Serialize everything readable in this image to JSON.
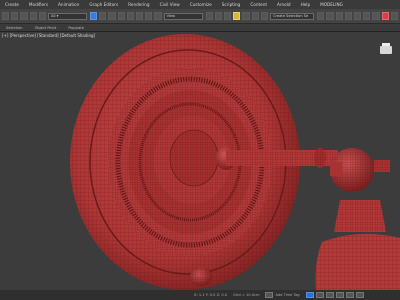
{
  "menu": [
    "Create",
    "Modifiers",
    "Animation",
    "Graph Editors",
    "Rendering",
    "Civil View",
    "Customize",
    "Scripting",
    "Content",
    "Arnold",
    "Help",
    "MODELING"
  ],
  "toolbar": {
    "view_dropdown": "View",
    "selection_set_dropdown": "Create Selection Se"
  },
  "subbar": [
    "Selection",
    "Object Paint",
    "Populate"
  ],
  "viewport": {
    "label": "[+] [Perspective] [Standard] [Default Shading]"
  },
  "status": {
    "coords": "X: 1.1  Y: 0.0  Z: 0.0",
    "grid": "Grid = 10.0cm",
    "add_time_tag": "Add Time Tag"
  },
  "colors": {
    "mesh": "#b83b3b",
    "mesh_dark": "#7d1f1f",
    "wire": "#5a1414",
    "viewport_bg": "#3c3c3c"
  }
}
